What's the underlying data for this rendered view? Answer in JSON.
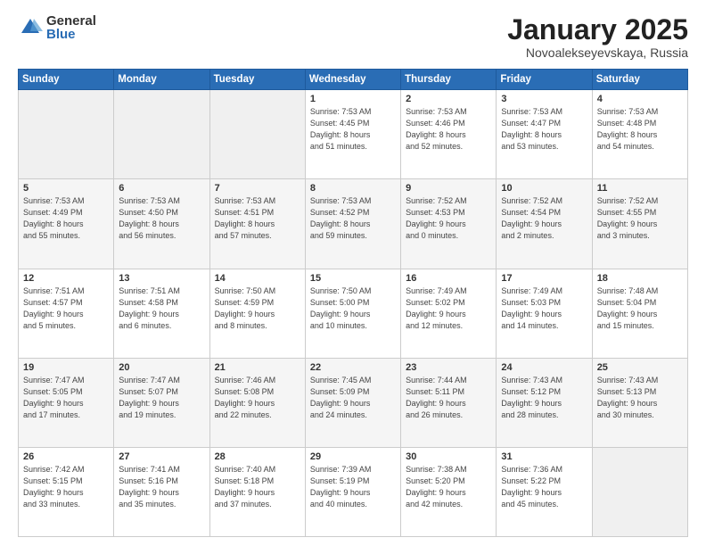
{
  "header": {
    "logo_general": "General",
    "logo_blue": "Blue",
    "title": "January 2025",
    "subtitle": "Novoalekseyevskaya, Russia"
  },
  "days_of_week": [
    "Sunday",
    "Monday",
    "Tuesday",
    "Wednesday",
    "Thursday",
    "Friday",
    "Saturday"
  ],
  "weeks": [
    [
      {
        "day": "",
        "info": ""
      },
      {
        "day": "",
        "info": ""
      },
      {
        "day": "",
        "info": ""
      },
      {
        "day": "1",
        "info": "Sunrise: 7:53 AM\nSunset: 4:45 PM\nDaylight: 8 hours\nand 51 minutes."
      },
      {
        "day": "2",
        "info": "Sunrise: 7:53 AM\nSunset: 4:46 PM\nDaylight: 8 hours\nand 52 minutes."
      },
      {
        "day": "3",
        "info": "Sunrise: 7:53 AM\nSunset: 4:47 PM\nDaylight: 8 hours\nand 53 minutes."
      },
      {
        "day": "4",
        "info": "Sunrise: 7:53 AM\nSunset: 4:48 PM\nDaylight: 8 hours\nand 54 minutes."
      }
    ],
    [
      {
        "day": "5",
        "info": "Sunrise: 7:53 AM\nSunset: 4:49 PM\nDaylight: 8 hours\nand 55 minutes."
      },
      {
        "day": "6",
        "info": "Sunrise: 7:53 AM\nSunset: 4:50 PM\nDaylight: 8 hours\nand 56 minutes."
      },
      {
        "day": "7",
        "info": "Sunrise: 7:53 AM\nSunset: 4:51 PM\nDaylight: 8 hours\nand 57 minutes."
      },
      {
        "day": "8",
        "info": "Sunrise: 7:53 AM\nSunset: 4:52 PM\nDaylight: 8 hours\nand 59 minutes."
      },
      {
        "day": "9",
        "info": "Sunrise: 7:52 AM\nSunset: 4:53 PM\nDaylight: 9 hours\nand 0 minutes."
      },
      {
        "day": "10",
        "info": "Sunrise: 7:52 AM\nSunset: 4:54 PM\nDaylight: 9 hours\nand 2 minutes."
      },
      {
        "day": "11",
        "info": "Sunrise: 7:52 AM\nSunset: 4:55 PM\nDaylight: 9 hours\nand 3 minutes."
      }
    ],
    [
      {
        "day": "12",
        "info": "Sunrise: 7:51 AM\nSunset: 4:57 PM\nDaylight: 9 hours\nand 5 minutes."
      },
      {
        "day": "13",
        "info": "Sunrise: 7:51 AM\nSunset: 4:58 PM\nDaylight: 9 hours\nand 6 minutes."
      },
      {
        "day": "14",
        "info": "Sunrise: 7:50 AM\nSunset: 4:59 PM\nDaylight: 9 hours\nand 8 minutes."
      },
      {
        "day": "15",
        "info": "Sunrise: 7:50 AM\nSunset: 5:00 PM\nDaylight: 9 hours\nand 10 minutes."
      },
      {
        "day": "16",
        "info": "Sunrise: 7:49 AM\nSunset: 5:02 PM\nDaylight: 9 hours\nand 12 minutes."
      },
      {
        "day": "17",
        "info": "Sunrise: 7:49 AM\nSunset: 5:03 PM\nDaylight: 9 hours\nand 14 minutes."
      },
      {
        "day": "18",
        "info": "Sunrise: 7:48 AM\nSunset: 5:04 PM\nDaylight: 9 hours\nand 15 minutes."
      }
    ],
    [
      {
        "day": "19",
        "info": "Sunrise: 7:47 AM\nSunset: 5:05 PM\nDaylight: 9 hours\nand 17 minutes."
      },
      {
        "day": "20",
        "info": "Sunrise: 7:47 AM\nSunset: 5:07 PM\nDaylight: 9 hours\nand 19 minutes."
      },
      {
        "day": "21",
        "info": "Sunrise: 7:46 AM\nSunset: 5:08 PM\nDaylight: 9 hours\nand 22 minutes."
      },
      {
        "day": "22",
        "info": "Sunrise: 7:45 AM\nSunset: 5:09 PM\nDaylight: 9 hours\nand 24 minutes."
      },
      {
        "day": "23",
        "info": "Sunrise: 7:44 AM\nSunset: 5:11 PM\nDaylight: 9 hours\nand 26 minutes."
      },
      {
        "day": "24",
        "info": "Sunrise: 7:43 AM\nSunset: 5:12 PM\nDaylight: 9 hours\nand 28 minutes."
      },
      {
        "day": "25",
        "info": "Sunrise: 7:43 AM\nSunset: 5:13 PM\nDaylight: 9 hours\nand 30 minutes."
      }
    ],
    [
      {
        "day": "26",
        "info": "Sunrise: 7:42 AM\nSunset: 5:15 PM\nDaylight: 9 hours\nand 33 minutes."
      },
      {
        "day": "27",
        "info": "Sunrise: 7:41 AM\nSunset: 5:16 PM\nDaylight: 9 hours\nand 35 minutes."
      },
      {
        "day": "28",
        "info": "Sunrise: 7:40 AM\nSunset: 5:18 PM\nDaylight: 9 hours\nand 37 minutes."
      },
      {
        "day": "29",
        "info": "Sunrise: 7:39 AM\nSunset: 5:19 PM\nDaylight: 9 hours\nand 40 minutes."
      },
      {
        "day": "30",
        "info": "Sunrise: 7:38 AM\nSunset: 5:20 PM\nDaylight: 9 hours\nand 42 minutes."
      },
      {
        "day": "31",
        "info": "Sunrise: 7:36 AM\nSunset: 5:22 PM\nDaylight: 9 hours\nand 45 minutes."
      },
      {
        "day": "",
        "info": ""
      }
    ]
  ]
}
